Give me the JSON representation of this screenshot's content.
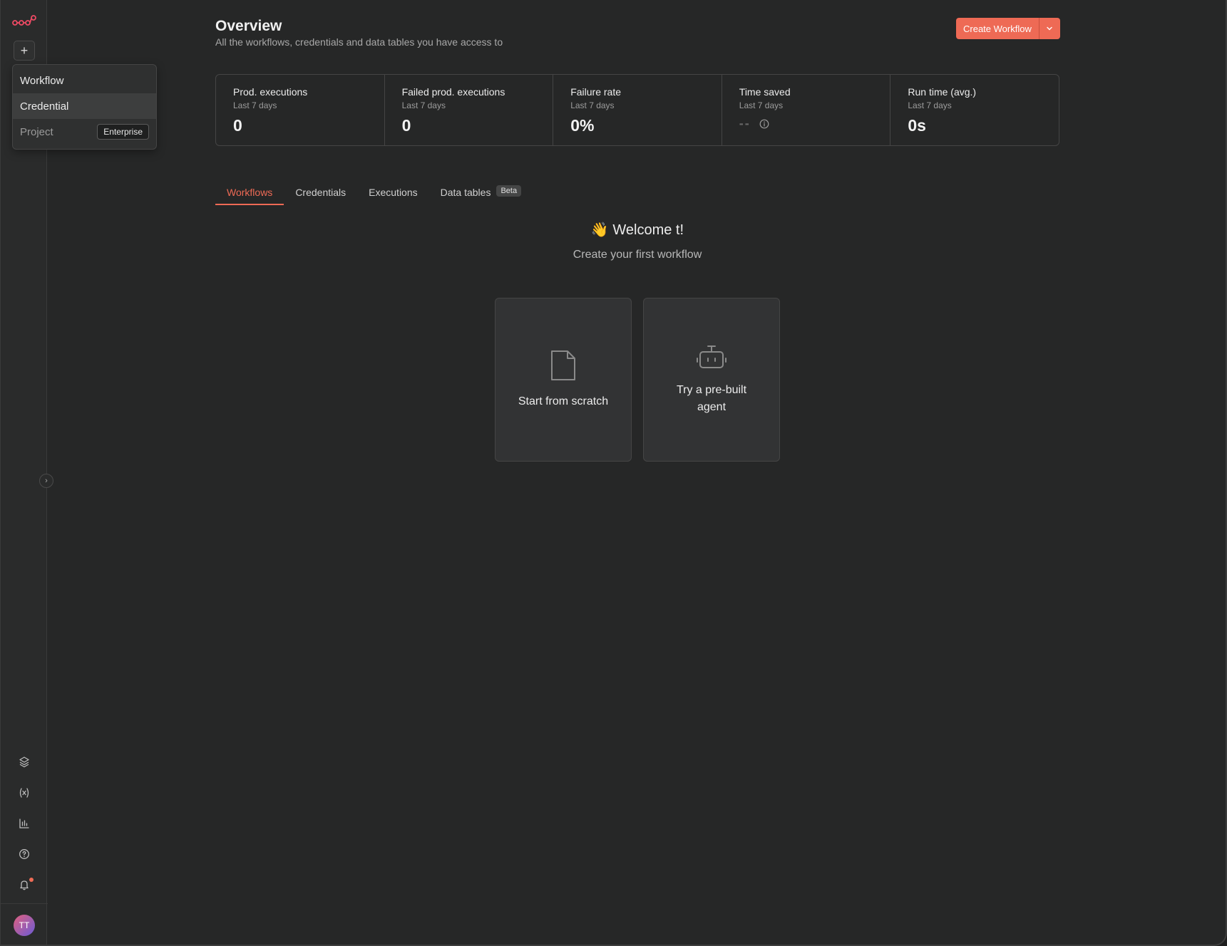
{
  "sidebar": {
    "icons": [
      "logo-icon",
      "plus-icon",
      "templates-icon",
      "variables-icon",
      "insights-icon",
      "help-icon",
      "bell-icon"
    ],
    "avatar_initials": "TT"
  },
  "menu": {
    "items": [
      {
        "label": "Workflow"
      },
      {
        "label": "Credential"
      },
      {
        "label": "Project",
        "badge": "Enterprise"
      }
    ]
  },
  "header": {
    "title": "Overview",
    "subtitle": "All the workflows, credentials and data tables you have access to",
    "create_button": "Create Workflow"
  },
  "stats": [
    {
      "label": "Prod. executions",
      "period": "Last 7 days",
      "value": "0"
    },
    {
      "label": "Failed prod. executions",
      "period": "Last 7 days",
      "value": "0"
    },
    {
      "label": "Failure rate",
      "period": "Last 7 days",
      "value": "0%"
    },
    {
      "label": "Time saved",
      "period": "Last 7 days",
      "value": "--"
    },
    {
      "label": "Run time (avg.)",
      "period": "Last 7 days",
      "value": "0s"
    }
  ],
  "tabs": [
    {
      "label": "Workflows"
    },
    {
      "label": "Credentials"
    },
    {
      "label": "Executions"
    },
    {
      "label": "Data tables",
      "badge": "Beta"
    }
  ],
  "welcome": {
    "emoji": "👋",
    "title": "Welcome t!",
    "subtitle": "Create your first workflow"
  },
  "cards": [
    {
      "label": "Start from scratch"
    },
    {
      "label": "Try a pre-built agent"
    }
  ],
  "colors": {
    "accent": "#ee6a55",
    "background": "#262727"
  }
}
